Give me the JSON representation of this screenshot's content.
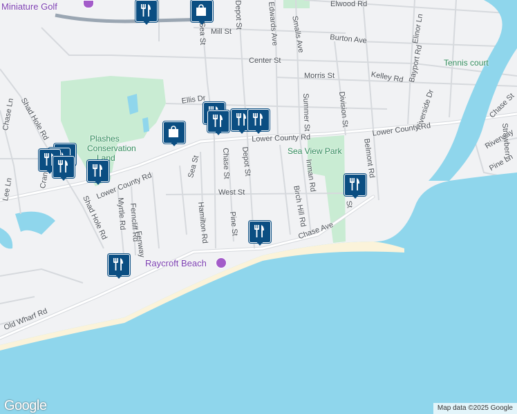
{
  "map": {
    "attribution": "Map data ©2025 Google",
    "logo": "Google"
  },
  "labels": {
    "miniature_golf": "Miniature Golf",
    "elwood_rd": "Elwood Rd",
    "edwards_ave": "Edwards Ave",
    "smalls_ave": "Smalls Ave",
    "burton_ave": "Burton Ave",
    "elinor_ln": "Elinor Ln",
    "mill_st": "Mill St",
    "sea_st_north": "Sea St",
    "depot_st_north": "Depot St",
    "center_st": "Center St",
    "bayport_rd": "Bayport Rd",
    "morris_st": "Morris St",
    "kelley_rd": "Kelley Rd",
    "tennis_court": "Tennis court",
    "riverside_dr": "Riverside Dr",
    "summer_st": "Summer St",
    "division_st": "Division St",
    "ellis_dr": "Ellis Dr",
    "chase_st_ne": "Chase St",
    "lower_county_rd_east": "Lower County Rd",
    "lower_county_rd_mid": "Lower County Rd",
    "lower_county_rd_west": "Lower County Rd",
    "riverway": "Riverway",
    "strawberry": "Strawberry",
    "pine_ln": "Pine Ln",
    "shad_hole_rd_north": "Shad Hole Rd",
    "shad_hole_rd_south": "Shad Hole Rd",
    "chase_ln": "Chase Ln",
    "plashes": "Plashes",
    "conservation": "Conservation",
    "land": "Land",
    "sea_view_park": "Sea View Park",
    "belmont_rd": "Belmont Rd",
    "sea_st_south": "Sea St",
    "chase_st": "Chase St",
    "depot_st": "Depot St",
    "inman_rd": "Inman Rd",
    "birch_hill_rd": "Birch Hill Rd",
    "west_st": "West St",
    "st_east": "St",
    "cranberry": "Cran",
    "lee_ln": "Lee Ln",
    "myrtle_rd": "Myrtle Rd",
    "forest": "Ferncliff Rd",
    "fenway": "Fenway",
    "hamilton_rd": "Hamilton Rd",
    "pine_st": "Pine St",
    "chase_ave": "Chase Ave",
    "raycroft_beach": "Raycroft Beach",
    "old_wharf_rd": "Old Wharf Rd"
  },
  "markers": [
    {
      "type": "restaurant",
      "icon": "fork-knife-icon"
    },
    {
      "type": "restaurant",
      "icon": "fork-knife-icon"
    },
    {
      "type": "restaurant",
      "icon": "fork-knife-icon"
    },
    {
      "type": "restaurant",
      "icon": "fork-knife-icon"
    },
    {
      "type": "restaurant",
      "icon": "fork-knife-icon"
    },
    {
      "type": "restaurant",
      "icon": "fork-knife-icon"
    },
    {
      "type": "restaurant",
      "icon": "fork-knife-icon"
    },
    {
      "type": "restaurant",
      "icon": "fork-knife-icon"
    },
    {
      "type": "restaurant",
      "icon": "fork-knife-icon"
    },
    {
      "type": "restaurant",
      "icon": "fork-knife-icon"
    },
    {
      "type": "restaurant",
      "icon": "fork-knife-icon"
    },
    {
      "type": "restaurant",
      "icon": "fork-knife-icon"
    },
    {
      "type": "shopping",
      "icon": "shopping-bag-icon"
    },
    {
      "type": "shopping",
      "icon": "shopping-bag-icon"
    },
    {
      "type": "restaurant",
      "icon": "fork-knife-icon"
    }
  ],
  "colors": {
    "water": "#8fd6ec",
    "land": "#f1f2f4",
    "park": "#c9ecd3",
    "road": "#ffffff",
    "road_outline": "#d3d6da",
    "highway": "#9aa6b2",
    "marker": "#0b4e82",
    "beach": "#fbf3da"
  }
}
